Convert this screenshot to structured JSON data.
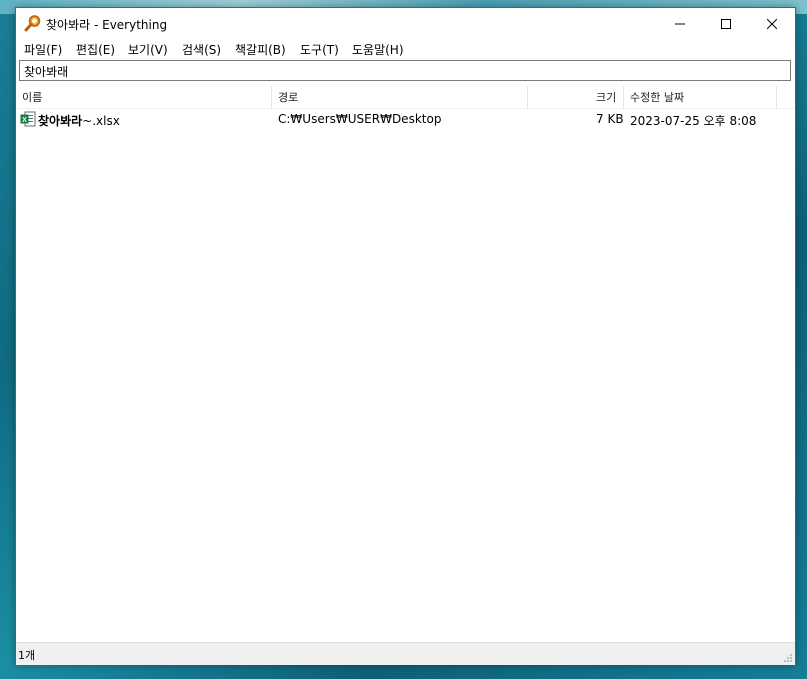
{
  "window": {
    "title": "찾아봐라 - Everything"
  },
  "menu": [
    "파일(F)",
    "편집(E)",
    "보기(V)",
    "검색(S)",
    "책갈피(B)",
    "도구(T)",
    "도움말(H)"
  ],
  "search": {
    "value": "찾아봐래"
  },
  "columns": {
    "name": "이름",
    "path": "경로",
    "size": "크기",
    "modified": "수정한 날짜"
  },
  "rows": [
    {
      "name_bold": "찾아봐라",
      "name_rest": "~.xlsx",
      "path": "C:₩Users₩USER₩Desktop",
      "size": "7 KB",
      "modified": "2023-07-25 오후 8:08",
      "icon": "excel-file-icon"
    }
  ],
  "status": {
    "count": "1개"
  },
  "colors": {
    "accent_icon": "#e07a10",
    "excel_green": "#1d7a45"
  }
}
